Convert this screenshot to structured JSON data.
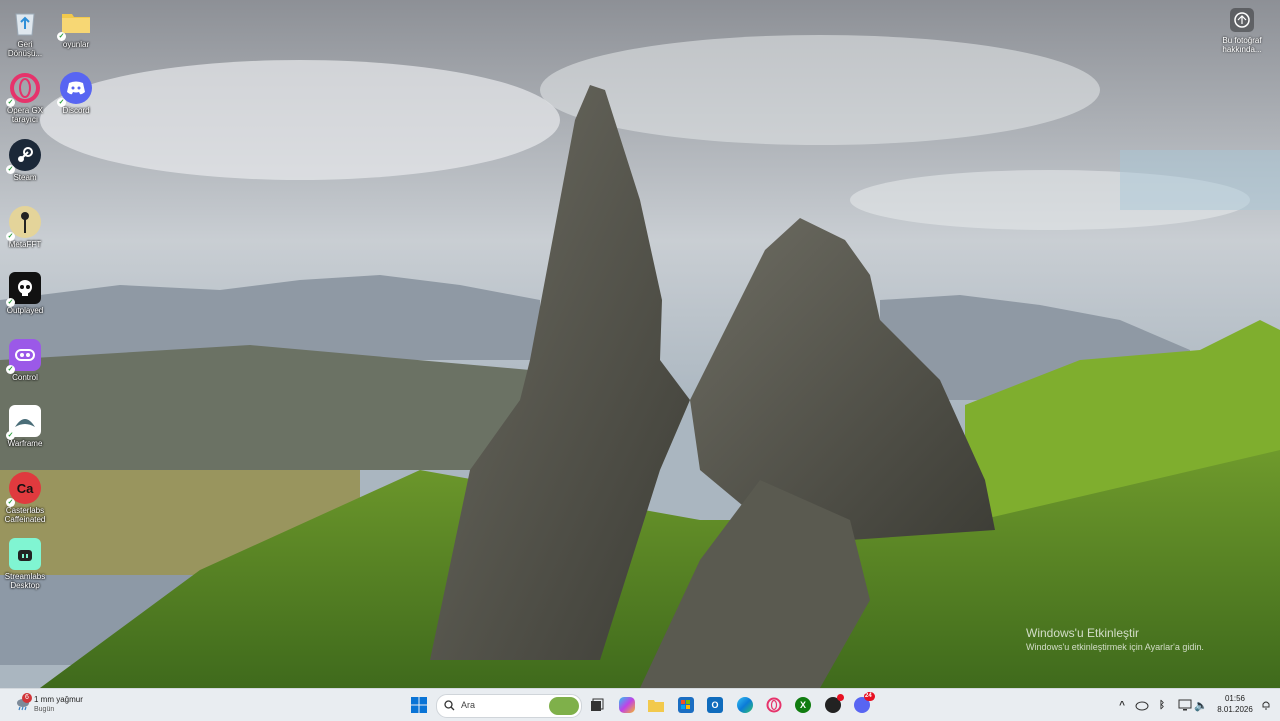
{
  "desktop": {
    "icons": [
      {
        "label": "Geri Dönüşü...",
        "name": "recycle-bin-icon"
      },
      {
        "label": "oyunlar",
        "name": "folder-icon"
      },
      {
        "label": "Opera GX tarayıcı",
        "name": "opera-gx-icon"
      },
      {
        "label": "Discord",
        "name": "discord-icon"
      },
      {
        "label": "Steam",
        "name": "steam-icon"
      },
      {
        "label": "MetaFFT",
        "name": "metafft-icon"
      },
      {
        "label": "Outplayed",
        "name": "outplayed-icon"
      },
      {
        "label": "Control",
        "name": "control-icon"
      },
      {
        "label": "Warframe",
        "name": "warframe-icon"
      },
      {
        "label": "Casterlabs Caffeinated",
        "name": "casterlabs-icon",
        "glyph": "Ca"
      },
      {
        "label": "Streamlabs Desktop",
        "name": "streamlabs-icon"
      }
    ],
    "about_photo": "Bu fotoğraf hakkında...",
    "activation_title": "Windows'u Etkinleştir",
    "activation_subtitle": "Windows'u etkinleştirmek için Ayarlar'a gidin."
  },
  "taskbar": {
    "weather_text": "1 mm yağmur",
    "weather_sub": "Bugün",
    "weather_badge": "6",
    "search_placeholder": "Ara",
    "pinned": [
      "windows-start-icon",
      "search-icon",
      "task-view-icon",
      "copilot-icon",
      "file-explorer-icon",
      "microsoft-store-icon",
      "outlook-icon",
      "edge-icon",
      "opera-gx-icon",
      "xbox-icon",
      "obs-icon",
      "discord-icon"
    ],
    "discord_badge": "24",
    "time": "01:56",
    "date": "8.01.2026"
  },
  "colors": {
    "taskbar": "#e9edf1",
    "accent": "#0067c0"
  }
}
